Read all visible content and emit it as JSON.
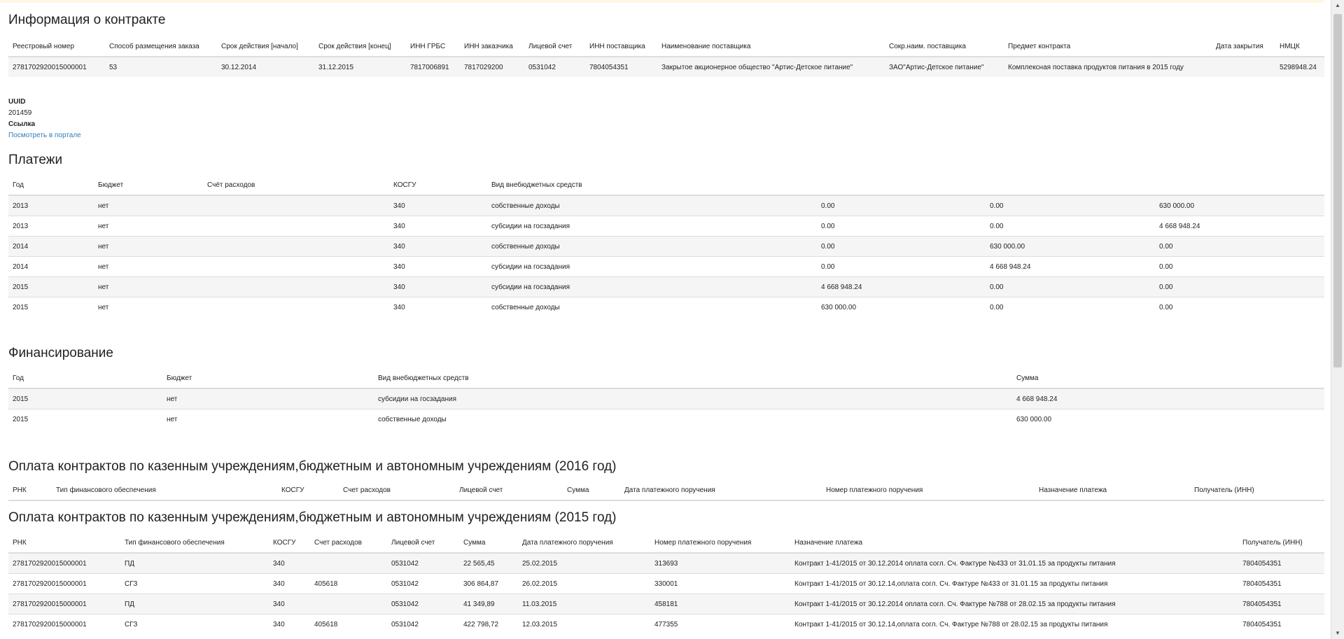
{
  "contract": {
    "title": "Информация о контракте",
    "columns": [
      "Реестровый номер",
      "Способ размещения заказа",
      "Срок действия [начало]",
      "Срок действия [конец]",
      "ИНН ГРБС",
      "ИНН заказчика",
      "Лицевой счет",
      "ИНН поставщика",
      "Наименование поставщика",
      "Сокр.наим. поставщика",
      "Предмет контракта",
      "Дата закрытия",
      "НМЦК"
    ],
    "rows": [
      [
        "2781702920015000001",
        "53",
        "30.12.2014",
        "31.12.2015",
        "7817006891",
        "7817029200",
        "0531042",
        "7804054351",
        "Закрытое акционерное общество \"Артис-Детское питание\"",
        "ЗАО\"Артис-Детское питание\"",
        "Комплексная поставка продуктов питания в 2015 году",
        "",
        "5298948.24"
      ]
    ]
  },
  "meta": {
    "uuid_label": "UUID",
    "uuid_value": "201459",
    "link_label": "Ссылка",
    "link_text": "Посмотреть в портале"
  },
  "payments": {
    "title": "Платежи",
    "columns": [
      "Год",
      "Бюджет",
      "Счёт расходов",
      "КОСГУ",
      "Вид внебюджетных средств",
      "",
      "",
      ""
    ],
    "rows": [
      [
        "2013",
        "нет",
        "",
        "340",
        "собственные доходы",
        "0.00",
        "0.00",
        "630 000.00"
      ],
      [
        "2013",
        "нет",
        "",
        "340",
        "субсидии на госзадания",
        "0.00",
        "0.00",
        "4 668 948.24"
      ],
      [
        "2014",
        "нет",
        "",
        "340",
        "собственные доходы",
        "0.00",
        "630 000.00",
        "0.00"
      ],
      [
        "2014",
        "нет",
        "",
        "340",
        "субсидии на госзадания",
        "0.00",
        "4 668 948.24",
        "0.00"
      ],
      [
        "2015",
        "нет",
        "",
        "340",
        "субсидии на госзадания",
        "4 668 948.24",
        "0.00",
        "0.00"
      ],
      [
        "2015",
        "нет",
        "",
        "340",
        "собственные доходы",
        "630 000.00",
        "0.00",
        "0.00"
      ]
    ]
  },
  "financing": {
    "title": "Финансирование",
    "columns": [
      "Год",
      "Бюджет",
      "Вид внебюджетных средств",
      "Сумма"
    ],
    "rows": [
      [
        "2015",
        "нет",
        "субсидии на госзадания",
        "4 668 948.24"
      ],
      [
        "2015",
        "нет",
        "собственные доходы",
        "630 000.00"
      ]
    ]
  },
  "pay2016": {
    "title": "Оплата контрактов по казенным учреждениям,бюджетным и автономным учреждениям (2016 год)",
    "columns": [
      "РНК",
      "Тип финансового обеспечения",
      "КОСГУ",
      "Счет расходов",
      "Лицевой счет",
      "Сумма",
      "Дата платежного поручения",
      "Номер платежного поручения",
      "Назначение платежа",
      "Получатель (ИНН)"
    ],
    "rows": []
  },
  "pay2015": {
    "title": "Оплата контрактов по казенным учреждениям,бюджетным и автономным учреждениям (2015 год)",
    "columns": [
      "РНК",
      "Тип финансового обеспечения",
      "КОСГУ",
      "Счет расходов",
      "Лицевой счет",
      "Сумма",
      "Дата платежного поручения",
      "Номер платежного поручения",
      "Назначение платежа",
      "Получатель (ИНН)"
    ],
    "rows": [
      [
        "2781702920015000001",
        "ПД",
        "340",
        "",
        "0531042",
        "22 565,45",
        "25.02.2015",
        "313693",
        "Контракт 1-41/2015 от 30.12.2014 оплата согл. Сч. Фактуре №433 от 31.01.15 за продукты питания",
        "7804054351"
      ],
      [
        "2781702920015000001",
        "СГЗ",
        "340",
        "405618",
        "0531042",
        "306 864,87",
        "26.02.2015",
        "330001",
        "Контракт 1-41/2015 от 30.12.14,оплата согл. Сч. Фактуре №433 от 31.01.15 за продукты питания",
        "7804054351"
      ],
      [
        "2781702920015000001",
        "ПД",
        "340",
        "",
        "0531042",
        "41 349,89",
        "11.03.2015",
        "458181",
        "Контракт 1-41/2015 от 30.12.2014 оплата согл. Сч. Фактуре №788 от 28.02.15 за продукты питания",
        "7804054351"
      ],
      [
        "2781702920015000001",
        "СГЗ",
        "340",
        "405618",
        "0531042",
        "422 798,72",
        "12.03.2015",
        "477355",
        "Контракт 1-41/2015 от 30.12.14,оплата согл. Сч. Фактуре №788 от 28.02.15 за продукты питания",
        "7804054351"
      ]
    ]
  }
}
